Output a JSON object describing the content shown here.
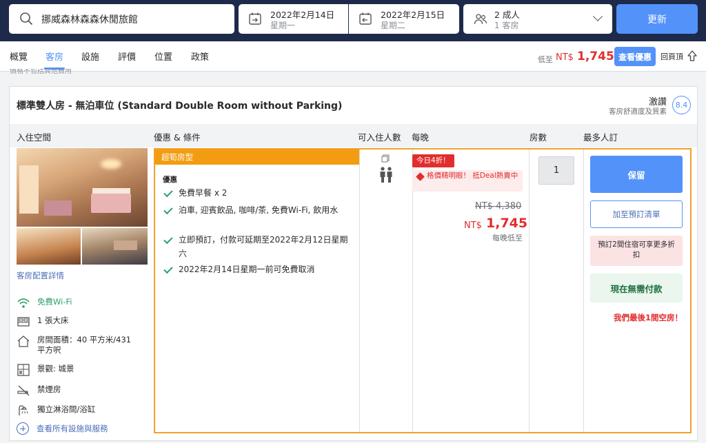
{
  "search": {
    "hotel": "挪威森林森森休閒旅館"
  },
  "dates": {
    "checkin": {
      "date": "2022年2月14日",
      "weekday": "星期一"
    },
    "checkout": {
      "date": "2022年2月15日",
      "weekday": "星期二"
    }
  },
  "guests": {
    "adults": "2 成人",
    "rooms": "1 客房"
  },
  "update_label": "更新",
  "tabs": [
    {
      "label": "概覽"
    },
    {
      "label": "客房"
    },
    {
      "label": "設施"
    },
    {
      "label": "評價"
    },
    {
      "label": "位置"
    },
    {
      "label": "政策"
    }
  ],
  "active_tab": "客房",
  "sticky_price": {
    "prefix": "低至",
    "currency": "NT$",
    "amount": "1,745"
  },
  "view_deal_label": "查看優惠",
  "back_to_top_label": "回頁頂",
  "cut_note": "價格不包括其他費用",
  "room": {
    "title": "標準雙人房 - 無泊車位 (Standard Double Room without Parking)",
    "review_word": "激讚",
    "review_sub": "客房舒適度及質素",
    "score": "8.4"
  },
  "columns": {
    "space": "入住空間",
    "offer": "優惠 & 條件",
    "occupancy": "可入住人數",
    "per_night": "每晚",
    "rooms": "房數",
    "max_book": "最多人訂"
  },
  "room_layout_link": "客房配置詳情",
  "amenities": [
    {
      "icon": "wifi-icon",
      "label": "免費Wi-Fi"
    },
    {
      "icon": "bed-icon",
      "label": "1 張大床"
    },
    {
      "icon": "house-icon",
      "label": "房間面積：40 平方米/431 平方呎"
    },
    {
      "icon": "window-view-icon",
      "label": "景觀: 城景"
    },
    {
      "icon": "no-smoking-icon",
      "label": "禁煙房"
    },
    {
      "icon": "shower-icon",
      "label": "獨立淋浴間/浴缸"
    }
  ],
  "all_facilities_link": "查看所有設施與服務",
  "offer": {
    "tag": "超筍房型",
    "perks_title": "優惠",
    "perks": [
      "免費早餐 x 2",
      "泊車, 迎賓飲品, 咖啡/茶, 免費Wi-Fi, 飲用水",
      "立即預訂，付款可延期至2022年2月12日星期六",
      "2022年2月14日星期一前可免費取消"
    ],
    "deal_badge": "今日4折！",
    "deal_text": "格價精明眼！ 抵Deal熱賣中",
    "original_price": "NT$ 4,380",
    "currency": "NT$",
    "price": "1,745",
    "per_night_note": "每晚低至",
    "qty": "1",
    "reserve_label": "保留",
    "add_list_label": "加至預訂清單",
    "promo_text": "預訂2間住宿可享更多折扣",
    "no_pay_now": "現在無需付款",
    "last_room": "我們最後1間空房！"
  },
  "colors": {
    "accent": "#5392f9",
    "deal": "#e12d2d",
    "highlight": "#f1a128",
    "header": "#1e2a4a"
  }
}
